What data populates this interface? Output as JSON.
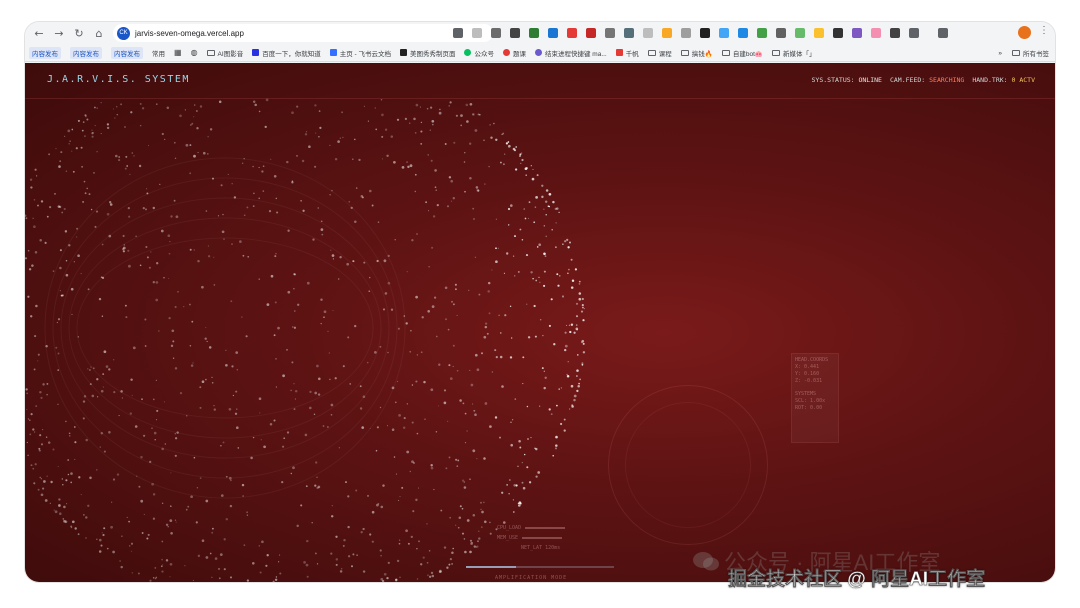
{
  "browser": {
    "url": "jarvis-seven-omega.vercel.app",
    "site_icon_text": "CK",
    "nav": [
      "back",
      "forward",
      "reload",
      "home"
    ]
  },
  "bookmarks": {
    "chips": [
      "内容发布",
      "内容发布",
      "内容发布"
    ],
    "items": [
      "常用",
      "AI图影音",
      "百度一下，你就知道",
      "主页 - 飞书云文档",
      "美图秀秀制页面",
      "公众号",
      "题课",
      "结束进程快捷键 ma...",
      "千帆",
      "课程",
      "搞钱🔥",
      "自建bot🐽",
      "新媒体「」"
    ],
    "more": "»",
    "all_bookmarks": "所有书签"
  },
  "hud": {
    "title": "J.A.R.V.I.S. SYSTEM",
    "sys_status_key": "SYS.STATUS:",
    "sys_status_val": "ONLINE",
    "cam_feed_key": "CAM.FEED:",
    "cam_feed_val": "SEARCHING",
    "hand_trk_key": "HAND.TRK:",
    "hand_trk_val": "0 ACTV"
  },
  "coords": {
    "title": "HEAD.COORDS",
    "x": "X: 0.441",
    "y": "Y: 0.160",
    "z": "Z: -0.031",
    "systems": "SYSTEMS",
    "scl": "SCL: 1.00x",
    "rot": "ROT: 0.00"
  },
  "meters": {
    "cpu": "CPU_LOAD",
    "mem": "MEM_USE",
    "net": "NET_LAT 120ms"
  },
  "amp": {
    "label": "AMPLIFICATION MODE",
    "level": 0.34
  },
  "colors": {
    "bg_center": "#7a1a1a",
    "bg_edge": "#3e0b0b",
    "title": "#9ad6e8",
    "warn": "#ff7e5f",
    "ok": "#f3c35a"
  },
  "watermark": {
    "back": "公众号 · 阿星AI工作室",
    "front": "掘金技术社区 @ 阿星AI工作室"
  }
}
